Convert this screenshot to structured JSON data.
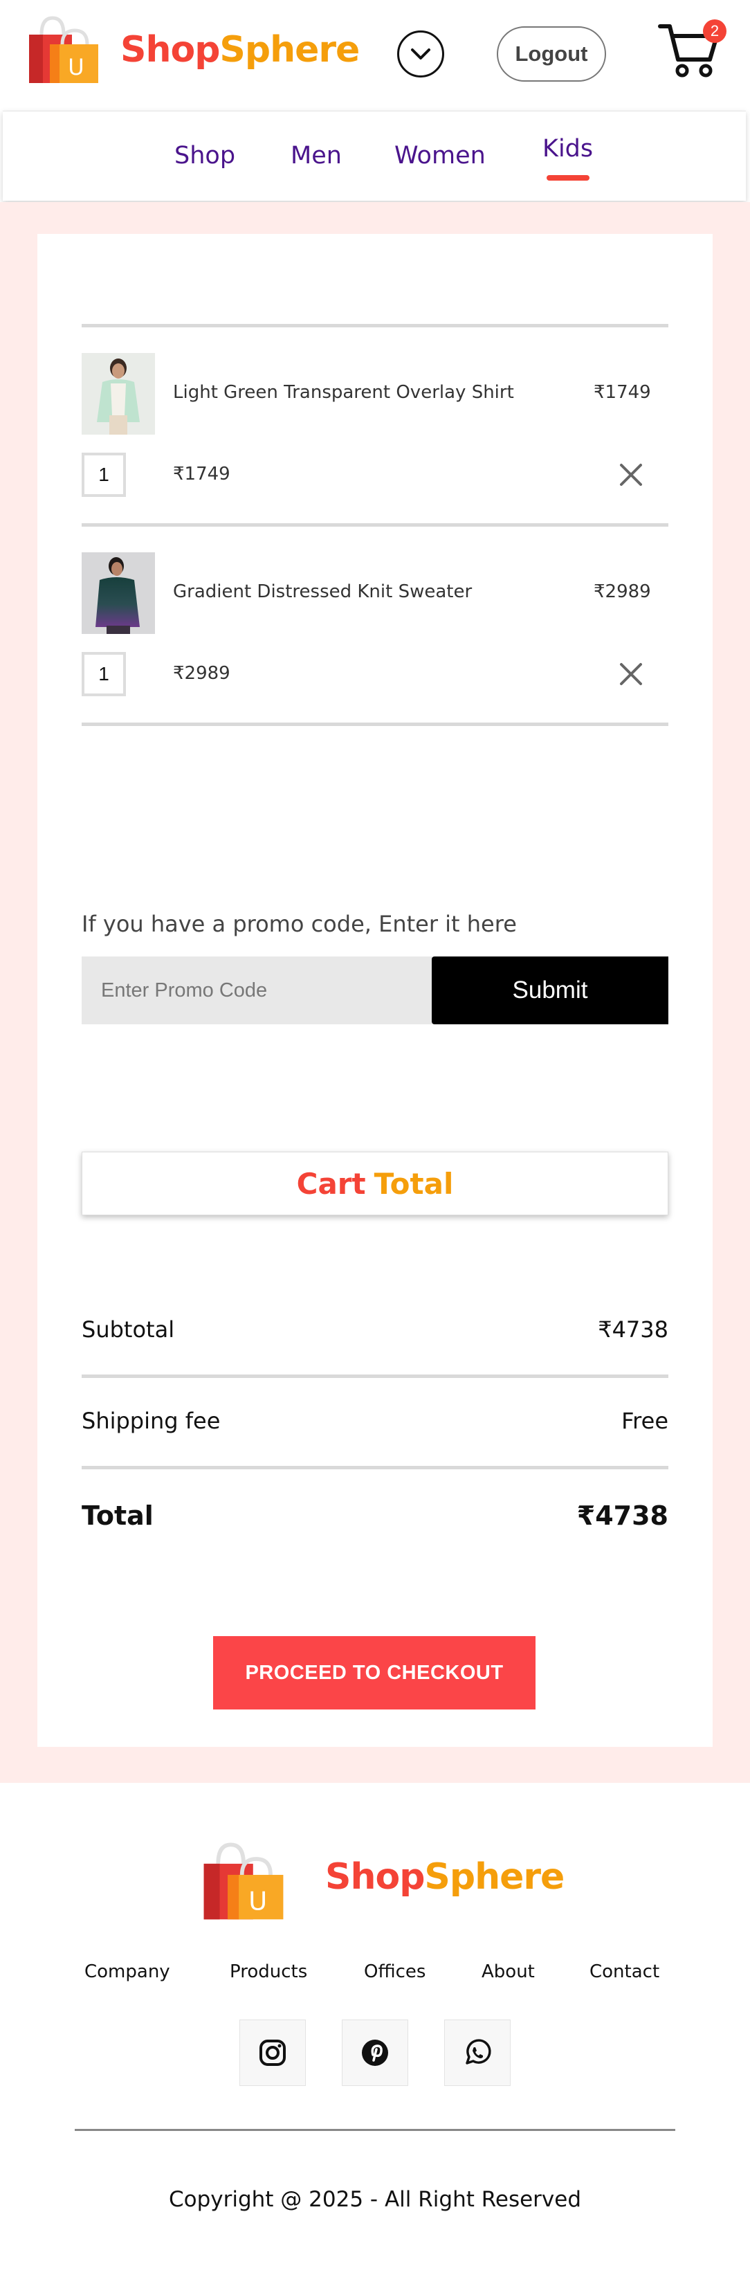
{
  "header": {
    "brand_part1": "Shop",
    "brand_part2": "Sphere",
    "logo_letter": "U",
    "logout_label": "Logout",
    "cart_count": "2"
  },
  "nav": {
    "items": [
      {
        "label": "Shop"
      },
      {
        "label": "Men"
      },
      {
        "label": "Women"
      },
      {
        "label": "Kids",
        "active": true
      }
    ]
  },
  "cart": {
    "items": [
      {
        "name": "Light Green Transparent Overlay Shirt",
        "price": "₹1749",
        "quantity": "1",
        "subtotal": "₹1749"
      },
      {
        "name": "Gradient Distressed Knit Sweater",
        "price": "₹2989",
        "quantity": "1",
        "subtotal": "₹2989"
      }
    ]
  },
  "promo": {
    "label": "If you have a promo code, Enter it here",
    "placeholder": "Enter Promo Code",
    "submit_label": "Submit"
  },
  "cart_total": {
    "title_part1": "Cart",
    "title_part2": "Total",
    "subtotal_label": "Subtotal",
    "subtotal_value": "₹4738",
    "shipping_label": "Shipping fee",
    "shipping_value": "Free",
    "total_label": "Total",
    "total_value": "₹4738",
    "checkout_label": "PROCEED TO CHECKOUT"
  },
  "footer": {
    "brand_part1": "Shop",
    "brand_part2": "Sphere",
    "links": [
      "Company",
      "Products",
      "Offices",
      "About",
      "Contact"
    ],
    "social_icons": [
      "instagram-icon",
      "pinterest-icon",
      "whatsapp-icon"
    ],
    "copyright": "Copyright @ 2025 - All Right Reserved"
  },
  "colors": {
    "accent_red": "#f44336",
    "accent_orange": "#f59e0b",
    "nav_purple": "#4a148c",
    "page_pink": "#ffecea",
    "checkout_red": "#fb4548"
  }
}
